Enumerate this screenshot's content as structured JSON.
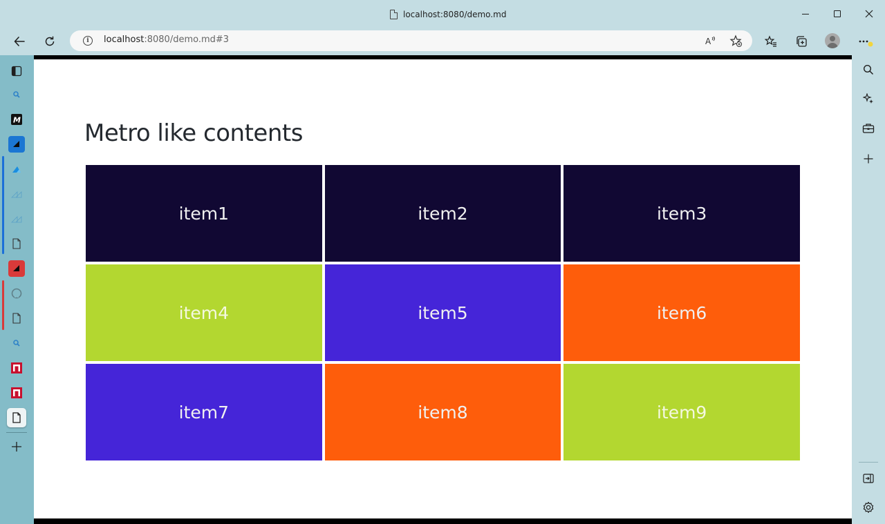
{
  "window": {
    "title": "localhost:8080/demo.md"
  },
  "toolbar": {
    "url_host": "localhost",
    "url_rest": ":8080/demo.md#3"
  },
  "page": {
    "heading": "Metro like contents",
    "tiles": [
      {
        "label": "item1",
        "color": "#110833"
      },
      {
        "label": "item2",
        "color": "#110833"
      },
      {
        "label": "item3",
        "color": "#110833"
      },
      {
        "label": "item4",
        "color": "#b3d730"
      },
      {
        "label": "item5",
        "color": "#4525d8"
      },
      {
        "label": "item6",
        "color": "#fe5d0b"
      },
      {
        "label": "item7",
        "color": "#4525d8"
      },
      {
        "label": "item8",
        "color": "#fe5d0b"
      },
      {
        "label": "item9",
        "color": "#b3d730"
      }
    ]
  },
  "icons": {
    "vertical_tabs": [
      "tab-actions-icon",
      "search-icon",
      "m-logo-icon",
      "azure-icon",
      "azure-icon",
      "azure-faded-icon",
      "azure-faded-icon",
      "document-icon",
      "red-azure-icon",
      "github-icon",
      "document-icon",
      "search-icon",
      "red-n-icon",
      "red-n-icon",
      "document-icon",
      "new-tab-icon"
    ],
    "right_sidebar": [
      "search-icon",
      "copilot-icon",
      "tools-icon",
      "add-icon",
      "hide-sidebar-icon",
      "settings-icon"
    ]
  },
  "colors": {
    "chrome": "#c4dde3",
    "vertical_tabs_bg": "#84bcc8",
    "group_blue": "#1a6fd8",
    "group_red": "#d93a3a"
  }
}
